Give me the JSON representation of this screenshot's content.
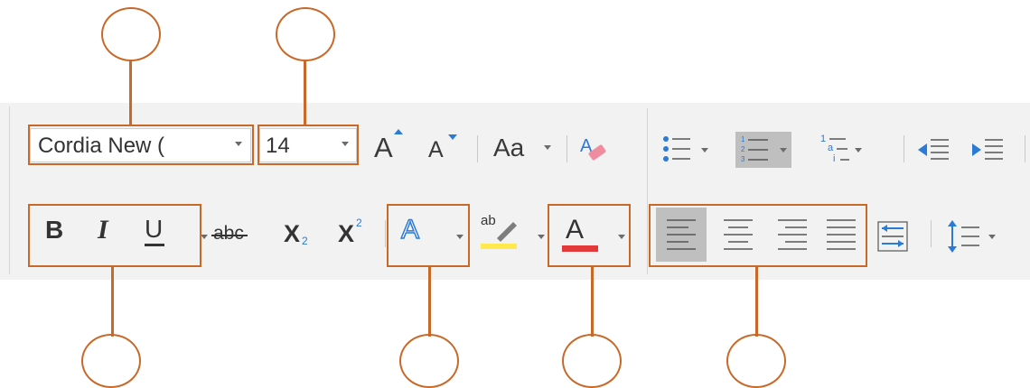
{
  "font": {
    "name_value": "Cordia New (",
    "size_value": "14"
  },
  "toolbar": {
    "grow_font": "A",
    "shrink_font": "A",
    "change_case": "Aa",
    "bold": "B",
    "italic": "I",
    "underline": "U",
    "strikethrough": "abc",
    "subscript_base": "X",
    "subscript_num": "2",
    "superscript_base": "X",
    "superscript_num": "2",
    "text_effects": "A",
    "highlight": "ab",
    "font_color": "A",
    "numbered_a": "a",
    "numbered_i": "i",
    "multilevel_1": "1"
  },
  "icons": {
    "clear_formatting": "eraser-icon",
    "bullets": "bullet-list-icon",
    "numbering": "numbered-list-icon",
    "multilevel": "multilevel-list-icon",
    "decrease_indent": "decrease-indent-icon",
    "increase_indent": "increase-indent-icon",
    "align_left": "align-left-icon",
    "align_center": "align-center-icon",
    "align_right": "align-right-icon",
    "justify": "justify-icon",
    "text_direction": "text-direction-icon",
    "line_spacing": "line-spacing-icon"
  },
  "colors": {
    "annotation": "#c8692a",
    "highlight_color": "#ffe94d",
    "font_color": "#e23a3a",
    "active_button": "#bfbfbf",
    "accent_blue": "#2a7ad6"
  }
}
